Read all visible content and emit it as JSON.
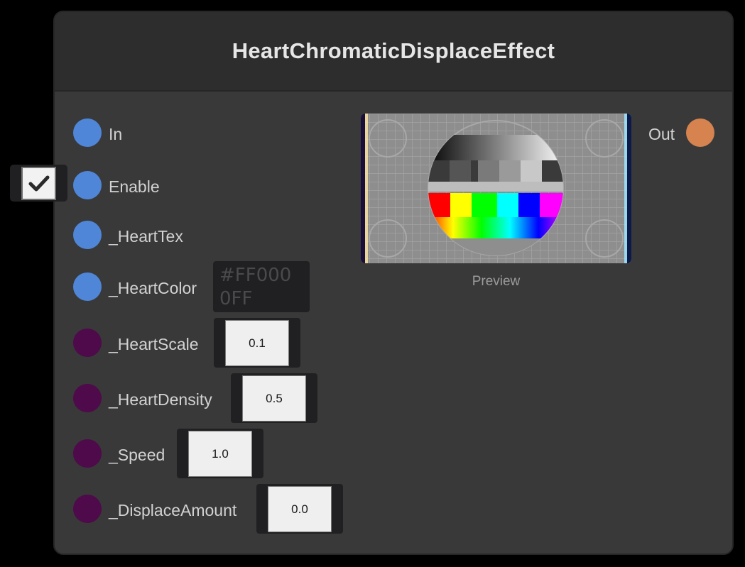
{
  "node": {
    "title": "HeartChromaticDisplaceEffect",
    "inputs": [
      {
        "label": "In",
        "port_color": "#4f86d8"
      },
      {
        "label": "Enable",
        "port_color": "#4f86d8",
        "value": true
      },
      {
        "label": "_HeartTex",
        "port_color": "#4f86d8"
      },
      {
        "label": "_HeartColor",
        "port_color": "#4f86d8",
        "value": "#FF000 0FF"
      },
      {
        "label": "_HeartScale",
        "port_color": "#4e0a4a",
        "value": "0.1"
      },
      {
        "label": "_HeartDensity",
        "port_color": "#4e0a4a",
        "value": "0.5"
      },
      {
        "label": "_Speed",
        "port_color": "#4e0a4a",
        "value": "1.0"
      },
      {
        "label": "_DisplaceAmount",
        "port_color": "#4e0a4a",
        "value": "0.0"
      }
    ],
    "output": {
      "label": "Out",
      "port_color": "#d6834f"
    },
    "preview_label": "Preview",
    "color_value_line1": "#FF000",
    "color_value_line2": "0FF",
    "checkmark_icon": "check-icon"
  }
}
